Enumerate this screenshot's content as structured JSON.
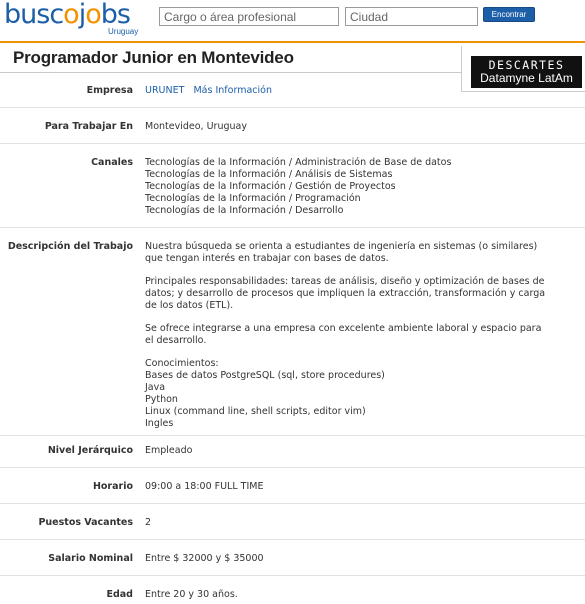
{
  "header": {
    "logo_text": "buscojobs",
    "logo_sub": "Uruguay",
    "search_placeholder": "Cargo o área profesional",
    "city_placeholder": "Ciudad",
    "find_button": "Encontrar"
  },
  "job": {
    "title": "Programador Junior en Montevideo",
    "company_logo_line1": "DESCARTES",
    "company_logo_line2": "Datamyne LatAm"
  },
  "fields": {
    "empresa": {
      "label": "Empresa",
      "company": "URUNET",
      "more_info": "Más Información"
    },
    "trabajar": {
      "label": "Para Trabajar En",
      "value": "Montevideo, Uruguay"
    },
    "canales": {
      "label": "Canales",
      "items": [
        "Tecnologías de la Información / Administración de Base de datos",
        "Tecnologías de la Información / Análisis de Sistemas",
        "Tecnologías de la Información / Gestión de Proyectos",
        "Tecnologías de la Información / Programación",
        "Tecnologías de la Información / Desarrollo"
      ]
    },
    "descripcion": {
      "label": "Descripción del Trabajo",
      "p1": "Nuestra búsqueda se orienta a estudiantes de ingeniería en sistemas (o similares) que tengan interés en trabajar con bases de datos.",
      "p2": "Principales responsabilidades: tareas de análisis, diseño y optimización de bases de datos; y desarrollo de procesos que impliquen la extracción, transformación y carga de los datos (ETL).",
      "p3": "Se ofrece integrarse a una empresa con excelente ambiente laboral y espacio para el desarrollo.",
      "conocimientos": [
        "Conocimientos:",
        "Bases de datos PostgreSQL (sql, store procedures)",
        "Java",
        "Python",
        "Linux (command line, shell scripts, editor vim)",
        "Ingles"
      ]
    },
    "nivel": {
      "label": "Nivel Jerárquico",
      "value": "Empleado"
    },
    "horario": {
      "label": "Horario",
      "value": "09:00 a 18:00 FULL TIME"
    },
    "vacantes": {
      "label": "Puestos Vacantes",
      "value": "2"
    },
    "salario": {
      "label": "Salario Nominal",
      "value": "Entre $ 32000 y $ 35000"
    },
    "edad": {
      "label": "Edad",
      "value": "Entre 20 y 30 años."
    }
  },
  "colors": {
    "brand_blue": "#1c5ea8",
    "brand_orange": "#f29200"
  }
}
